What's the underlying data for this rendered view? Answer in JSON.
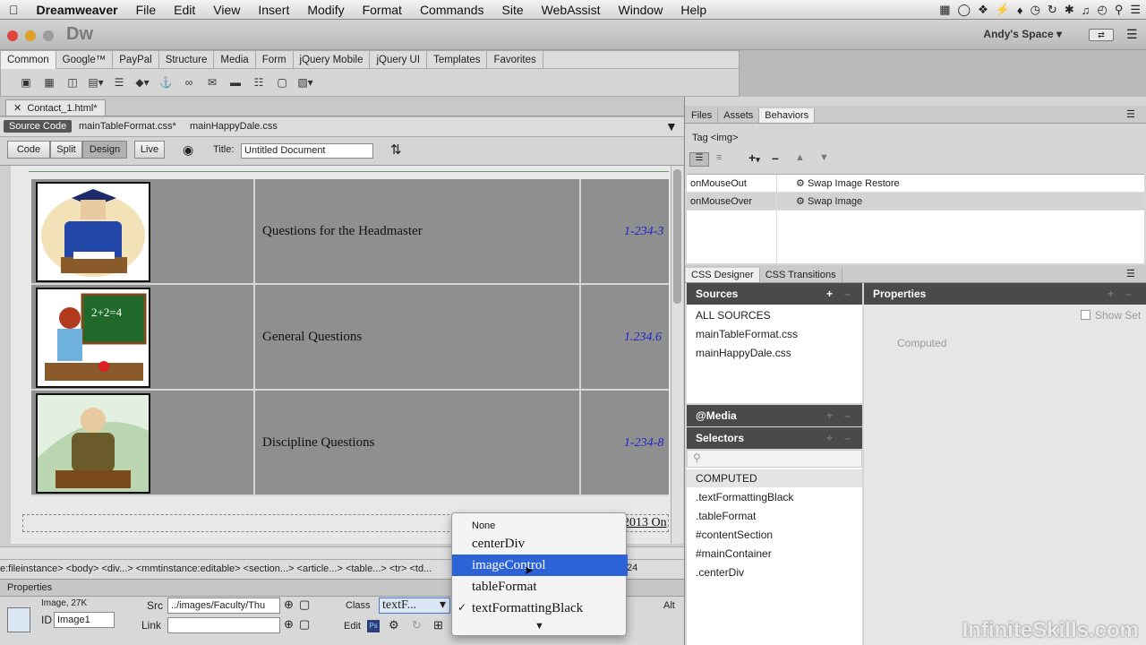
{
  "menubar": {
    "app": "Dreamweaver",
    "items": [
      "File",
      "Edit",
      "View",
      "Insert",
      "Modify",
      "Format",
      "Commands",
      "Site",
      "WebAssist",
      "Window",
      "Help"
    ]
  },
  "titlebar": {
    "logo": "Dw",
    "workspace": "Andy's Space"
  },
  "insert": {
    "tabs": [
      "Common",
      "Google™",
      "PayPal",
      "Structure",
      "Media",
      "Form",
      "jQuery Mobile",
      "jQuery UI",
      "Templates",
      "Favorites"
    ]
  },
  "document": {
    "tab": "Contact_1.html*",
    "related": [
      "Source Code",
      "mainTableFormat.css*",
      "mainHappyDale.css"
    ],
    "views": [
      "Code",
      "Split",
      "Design",
      "Live"
    ],
    "title_label": "Title:",
    "title_value": "Untitled Document"
  },
  "table": {
    "rows": [
      {
        "text": "Questions for the Headmaster",
        "phone": "1-234-3"
      },
      {
        "text": "General Questions",
        "phone": "1.234.6"
      },
      {
        "text": "Discipline Questions",
        "phone": "1-234-8"
      }
    ],
    "footer": "2013 On"
  },
  "tagselector": "e:fileinstance>  <body>  <div...>  <mmtinstance:editable>  <section...>  <article...>  <table...>  <tr>  <td...",
  "properties": {
    "title": "Properties",
    "image_info": "Image, 27K",
    "id_label": "ID",
    "id_value": "Image1",
    "src_label": "Src",
    "src_value": "../images/Faculty/Thu",
    "link_label": "Link",
    "link_value": "",
    "class_label": "Class",
    "class_value": "textF...",
    "edit_label": "Edit",
    "alt_label": "Alt",
    "zoom_fragment": "24"
  },
  "class_dropdown": {
    "items": [
      "None",
      "centerDiv",
      "imageControl",
      "tableFormat",
      "textFormattingBlack"
    ],
    "selected": "imageControl",
    "checked": "textFormattingBlack"
  },
  "right_panel": {
    "top_tabs": [
      "Files",
      "Assets",
      "Behaviors"
    ],
    "tag": "Tag <img>",
    "behaviors": [
      {
        "event": "onMouseOut",
        "action": "Swap Image Restore"
      },
      {
        "event": "onMouseOver",
        "action": "Swap Image"
      }
    ],
    "css_tabs": [
      "CSS Designer",
      "CSS Transitions"
    ],
    "sources_title": "Sources",
    "sources": [
      "ALL SOURCES",
      "mainTableFormat.css",
      "mainHappyDale.css"
    ],
    "properties_title": "Properties",
    "show_set": "Show Set",
    "computed": "Computed",
    "media_title": "@Media",
    "selectors_title": "Selectors",
    "selectors": [
      "COMPUTED",
      ".textFormattingBlack",
      ".tableFormat",
      "#contentSection",
      "#mainContainer",
      ".centerDiv"
    ]
  },
  "watermark": "InfiniteSkills.com"
}
